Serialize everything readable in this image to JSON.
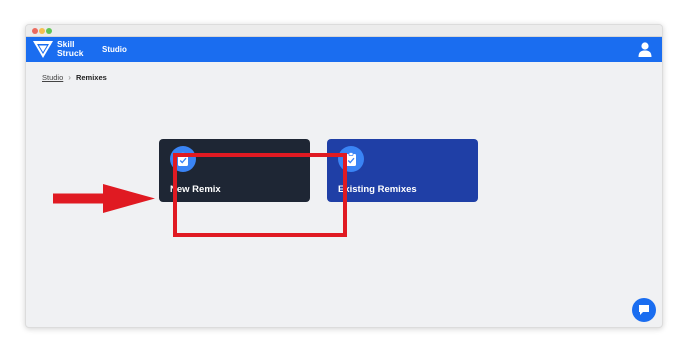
{
  "app": {
    "brand_line1": "Skill",
    "brand_line2": "Struck",
    "nav_studio": "Studio"
  },
  "breadcrumb": {
    "items": [
      "Studio",
      "Remixes"
    ]
  },
  "cards": [
    {
      "title": "New Remix",
      "icon": "clipboard-icon"
    },
    {
      "title": "Existing Remixes",
      "icon": "clipboard-icon"
    }
  ],
  "colors": {
    "navbar": "#1a6df0",
    "card_new": "#1e2634",
    "card_existing": "#1f3fa6",
    "icon_circle": "#3a84f5",
    "highlight": "#e01a22"
  },
  "icons": {
    "logo": "skillstruck-logo-icon",
    "user": "user-icon",
    "chat": "chat-bubble-icon",
    "breadcrumb_separator": "chevron-right-icon",
    "annotation_arrow": "arrow-right-icon"
  }
}
